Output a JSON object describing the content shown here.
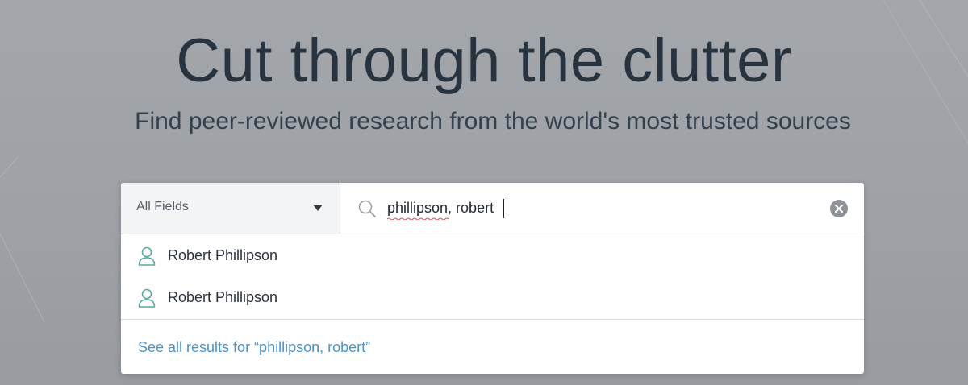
{
  "hero": {
    "title": "Cut through the clutter",
    "subtitle": "Find peer-reviewed research from the world's most trusted sources"
  },
  "search": {
    "field_select": {
      "selected": "All Fields",
      "icon": "chevron-down-icon"
    },
    "query": "phillipson, robert",
    "search_icon": "search-icon",
    "clear_icon": "clear-icon"
  },
  "suggestions": {
    "items": [
      {
        "label": "Robert Phillipson",
        "icon": "person-icon"
      },
      {
        "label": "Robert Phillipson",
        "icon": "person-icon"
      }
    ],
    "see_all": "See all results for “phillipson, robert”"
  },
  "colors": {
    "background": "#a0a3a7",
    "title_text": "#283340",
    "accent_link": "#4b93c9",
    "person_icon": "#5aa8a3"
  }
}
